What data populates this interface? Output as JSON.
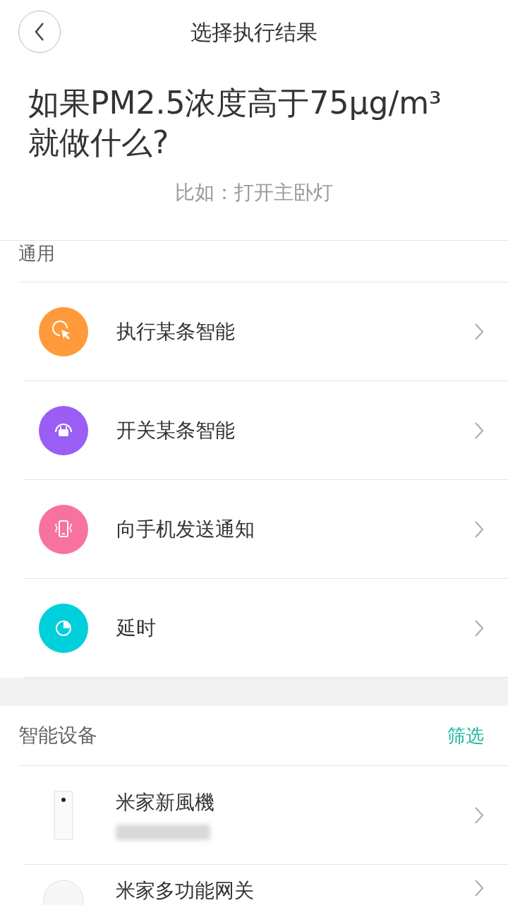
{
  "header": {
    "title": "选择执行结果"
  },
  "question": {
    "title": "如果PM2.5浓度高于75μg/m³就做什么?",
    "hint": "比如：打开主卧灯"
  },
  "general": {
    "heading": "通用",
    "items": [
      {
        "label": "执行某条智能",
        "color": "#ff9a3c"
      },
      {
        "label": "开关某条智能",
        "color": "#9a5ef5"
      },
      {
        "label": "向手机发送通知",
        "color": "#f7739e"
      },
      {
        "label": "延时",
        "color": "#00cfdc"
      }
    ]
  },
  "devices": {
    "heading": "智能设备",
    "filter": "筛选",
    "items": [
      {
        "name": "米家新風機"
      },
      {
        "name": "米家多功能网关"
      }
    ]
  }
}
